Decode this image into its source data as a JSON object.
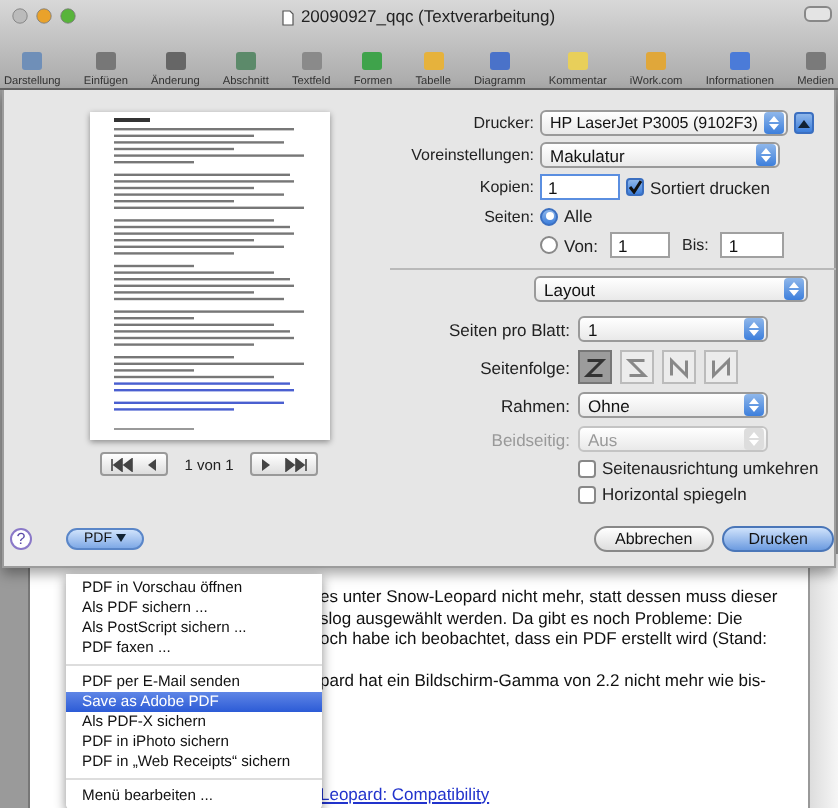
{
  "window": {
    "title": "20090927_qqc (Textverarbeitung)"
  },
  "toolbar": [
    {
      "label": "Darstellung"
    },
    {
      "label": "Einfügen"
    },
    {
      "label": "Änderung"
    },
    {
      "label": "Abschnitt"
    },
    {
      "label": "Textfeld"
    },
    {
      "label": "Formen"
    },
    {
      "label": "Tabelle"
    },
    {
      "label": "Diagramm"
    },
    {
      "label": "Kommentar"
    },
    {
      "label": "iWork.com"
    },
    {
      "label": "Informationen"
    },
    {
      "label": "Medien"
    }
  ],
  "print_dialog": {
    "preview": {
      "page_label": "1 von 1"
    },
    "printer": {
      "label": "Drucker:",
      "value": "HP LaserJet P3005 (9102F3)"
    },
    "presets": {
      "label": "Voreinstellungen:",
      "value": "Makulatur"
    },
    "copies": {
      "label": "Kopien:",
      "value": "1"
    },
    "collate": {
      "label": "Sortiert drucken",
      "checked": true
    },
    "pages": {
      "label": "Seiten:",
      "options": [
        {
          "label": "Alle",
          "selected": true
        },
        {
          "label": "Von:",
          "selected": false
        }
      ],
      "from": "1",
      "to_label": "Bis:",
      "to": "1"
    },
    "section": {
      "value": "Layout"
    },
    "pages_per_sheet": {
      "label": "Seiten pro Blatt:",
      "value": "1"
    },
    "page_order": {
      "label": "Seitenfolge:",
      "options": [
        {
          "selected": true
        },
        {
          "selected": false
        },
        {
          "selected": false
        },
        {
          "selected": false
        }
      ]
    },
    "border": {
      "label": "Rahmen:",
      "value": "Ohne"
    },
    "two_sided": {
      "label": "Beidseitig:",
      "value": "Aus",
      "disabled": true
    },
    "checkboxes": [
      {
        "label": "Seitenausrichtung umkehren",
        "checked": false
      },
      {
        "label": "Horizontal spiegeln",
        "checked": false
      }
    ],
    "help_button": "?",
    "pdf_button": "PDF",
    "cancel_button": "Abbrechen",
    "print_button": "Drucken"
  },
  "pdf_menu": [
    [
      {
        "label": "PDF in Vorschau öffnen",
        "selected": false
      },
      {
        "label": "Als PDF sichern ...",
        "selected": false
      },
      {
        "label": "Als PostScript sichern ...",
        "selected": false
      },
      {
        "label": "PDF faxen ...",
        "selected": false
      }
    ],
    [
      {
        "label": "PDF per E-Mail senden",
        "selected": false
      },
      {
        "label": "Save as Adobe PDF",
        "selected": true
      },
      {
        "label": "Als PDF-X sichern",
        "selected": false
      },
      {
        "label": "PDF in iPhoto sichern",
        "selected": false
      },
      {
        "label": "PDF in „Web Receipts“ sichern",
        "selected": false
      }
    ],
    [
      {
        "label": "Menü bearbeiten ...",
        "selected": false
      }
    ]
  ],
  "document": {
    "paragraphs": [
      [
        "es unter Snow-Leopard nicht mehr, statt dessen muss dieser",
        "slog ausgewählt werden. Da gibt es noch  Probleme: Die",
        "och habe ich beobachtet, dass ein PDF erstellt wird (Stand:"
      ],
      [
        "pard hat ein Bildschirm-Gamma von 2.2 nicht mehr wie bis-"
      ]
    ],
    "link": "Leopard: Compatibility"
  }
}
